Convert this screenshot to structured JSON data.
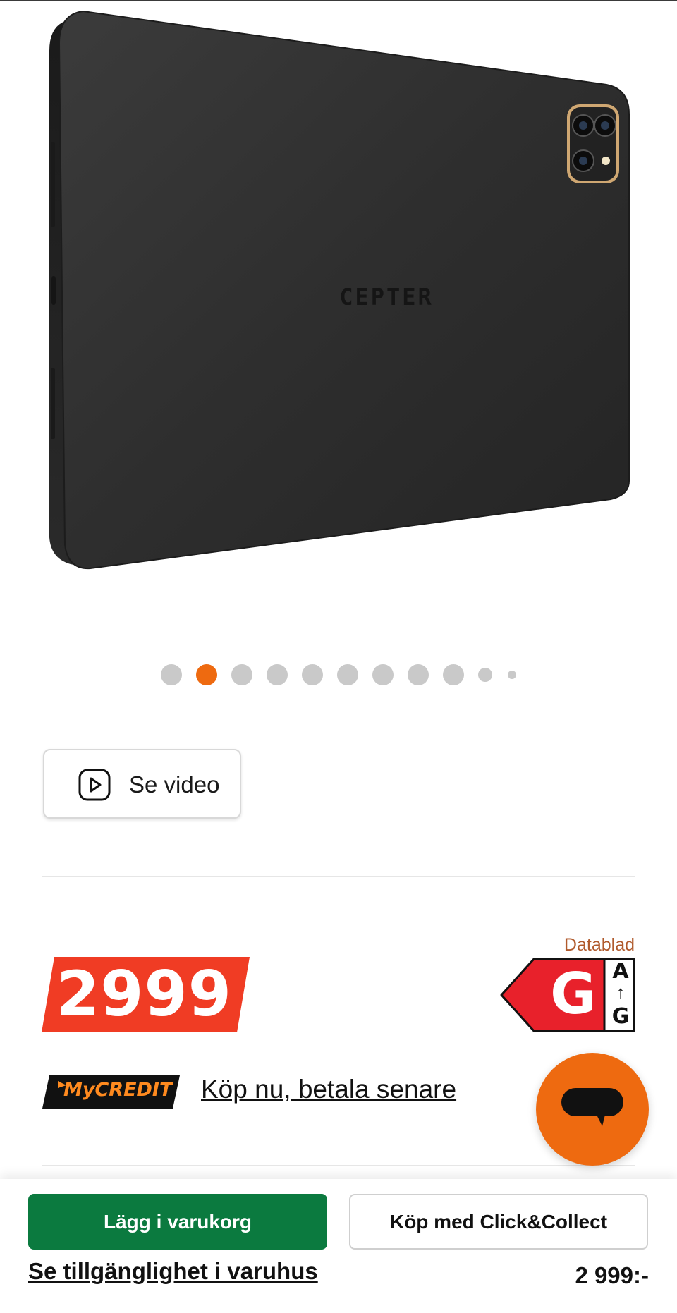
{
  "product": {
    "brand_logo_text": "CEPTER",
    "image_count": 11,
    "active_image_index": 1
  },
  "video_button": {
    "label": "Se video",
    "icon": "play-icon"
  },
  "price": {
    "amount": "2999",
    "tag_color": "#f03c24"
  },
  "energy_label": {
    "link": "Datablad",
    "grade": "G",
    "scale_top": "A",
    "scale_arrow": "↑",
    "scale_bottom": "G",
    "grade_color": "#e8212b"
  },
  "financing": {
    "logo_text": "MyCREDIT",
    "link_label": "Köp nu, betala senare"
  },
  "chat": {
    "icon": "chat-bubble-icon",
    "color": "#ee6a10"
  },
  "bottom_bar": {
    "add_to_cart_label": "Lägg i varukorg",
    "click_collect_label": "Köp med Click&Collect",
    "availability_link": "Se tillgänglighet i varuhus",
    "price": "2 999:-",
    "primary_color": "#0b7a3f"
  }
}
